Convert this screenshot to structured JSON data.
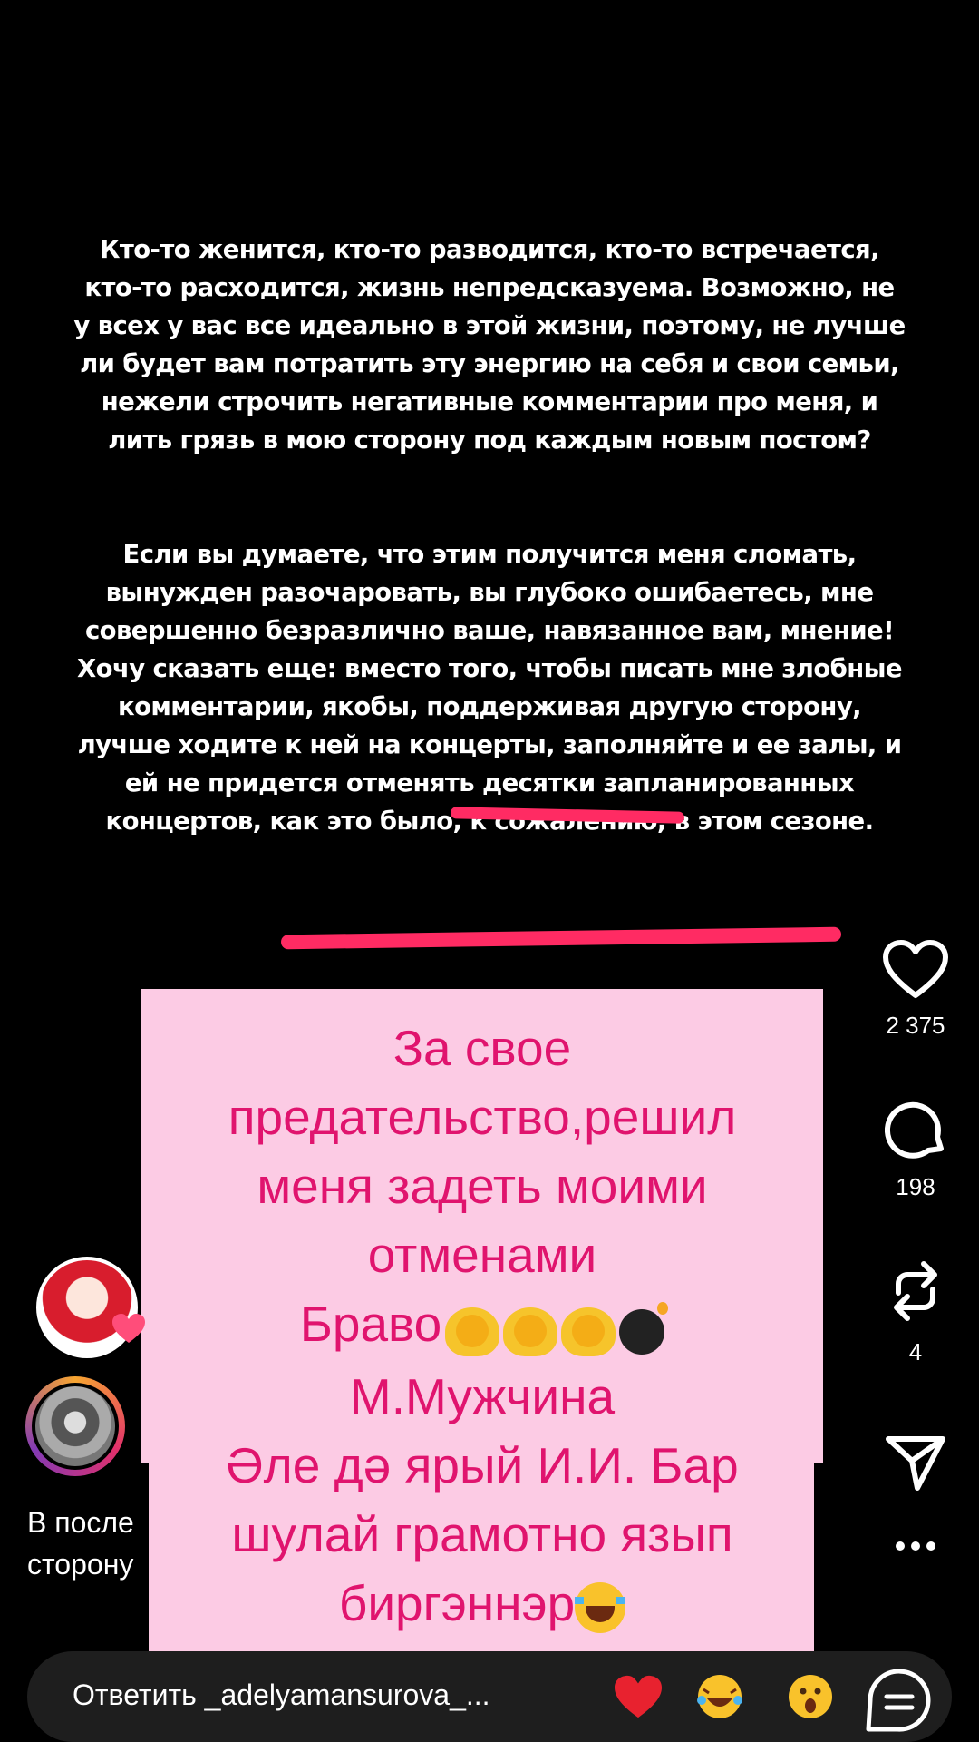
{
  "story": {
    "paragraph1": [
      "Кто-то женится, кто-то разводится, кто-то встречается,",
      "кто-то расходится, жизнь непредсказуема. Возможно, не",
      "у всех у вас все идеально в этой жизни, поэтому, не лучше",
      "ли будет вам потратить эту энергию на себя и свои семьи,",
      "нежели строчить негативные комментарии про меня, и",
      "лить грязь в мою сторону под каждым новым постом?"
    ],
    "paragraph2": [
      "Если вы думаете, что этим получится меня сломать,",
      "вынужден разочаровать, вы глубоко ошибаетесь, мне",
      "совершенно безразлично ваше, навязанное вам, мнение!",
      "Хочу сказать еще: вместо того, чтобы писать мне злобные",
      "комментарии, якобы, поддерживая другую сторону,",
      "лучше ходите к ней на концерты, заполняйте и ее залы, и",
      "ей не придется отменять десятки запланированных",
      "концертов, как это было, к сожалению, в этом сезоне."
    ]
  },
  "overlay": {
    "lines": [
      "За свое",
      "предательство,решил",
      "меня задеть моими",
      "отменами",
      "Браво",
      "М.Мужчина",
      "Әле дә ярый И.И. Бар",
      "шулай грамотно язып",
      "биргэннэр"
    ],
    "emoji_after_bravo": [
      "clapping-hands",
      "clapping-hands",
      "clapping-hands",
      "bomb"
    ],
    "emoji_after_last": "face-with-tears-of-joy",
    "text_color": "#e0146e",
    "background_color": "#fccbe4"
  },
  "actions": {
    "likes": "2 375",
    "comments": "198",
    "reposts": "4"
  },
  "caption": {
    "line1": "В после",
    "line2": "сторону"
  },
  "reply": {
    "placeholder": "Ответить _adelyamansurova_...",
    "quick_reactions": [
      "red-heart",
      "face-with-tears-of-joy",
      "astonished-face"
    ]
  },
  "accent_color": "#ff2b63"
}
